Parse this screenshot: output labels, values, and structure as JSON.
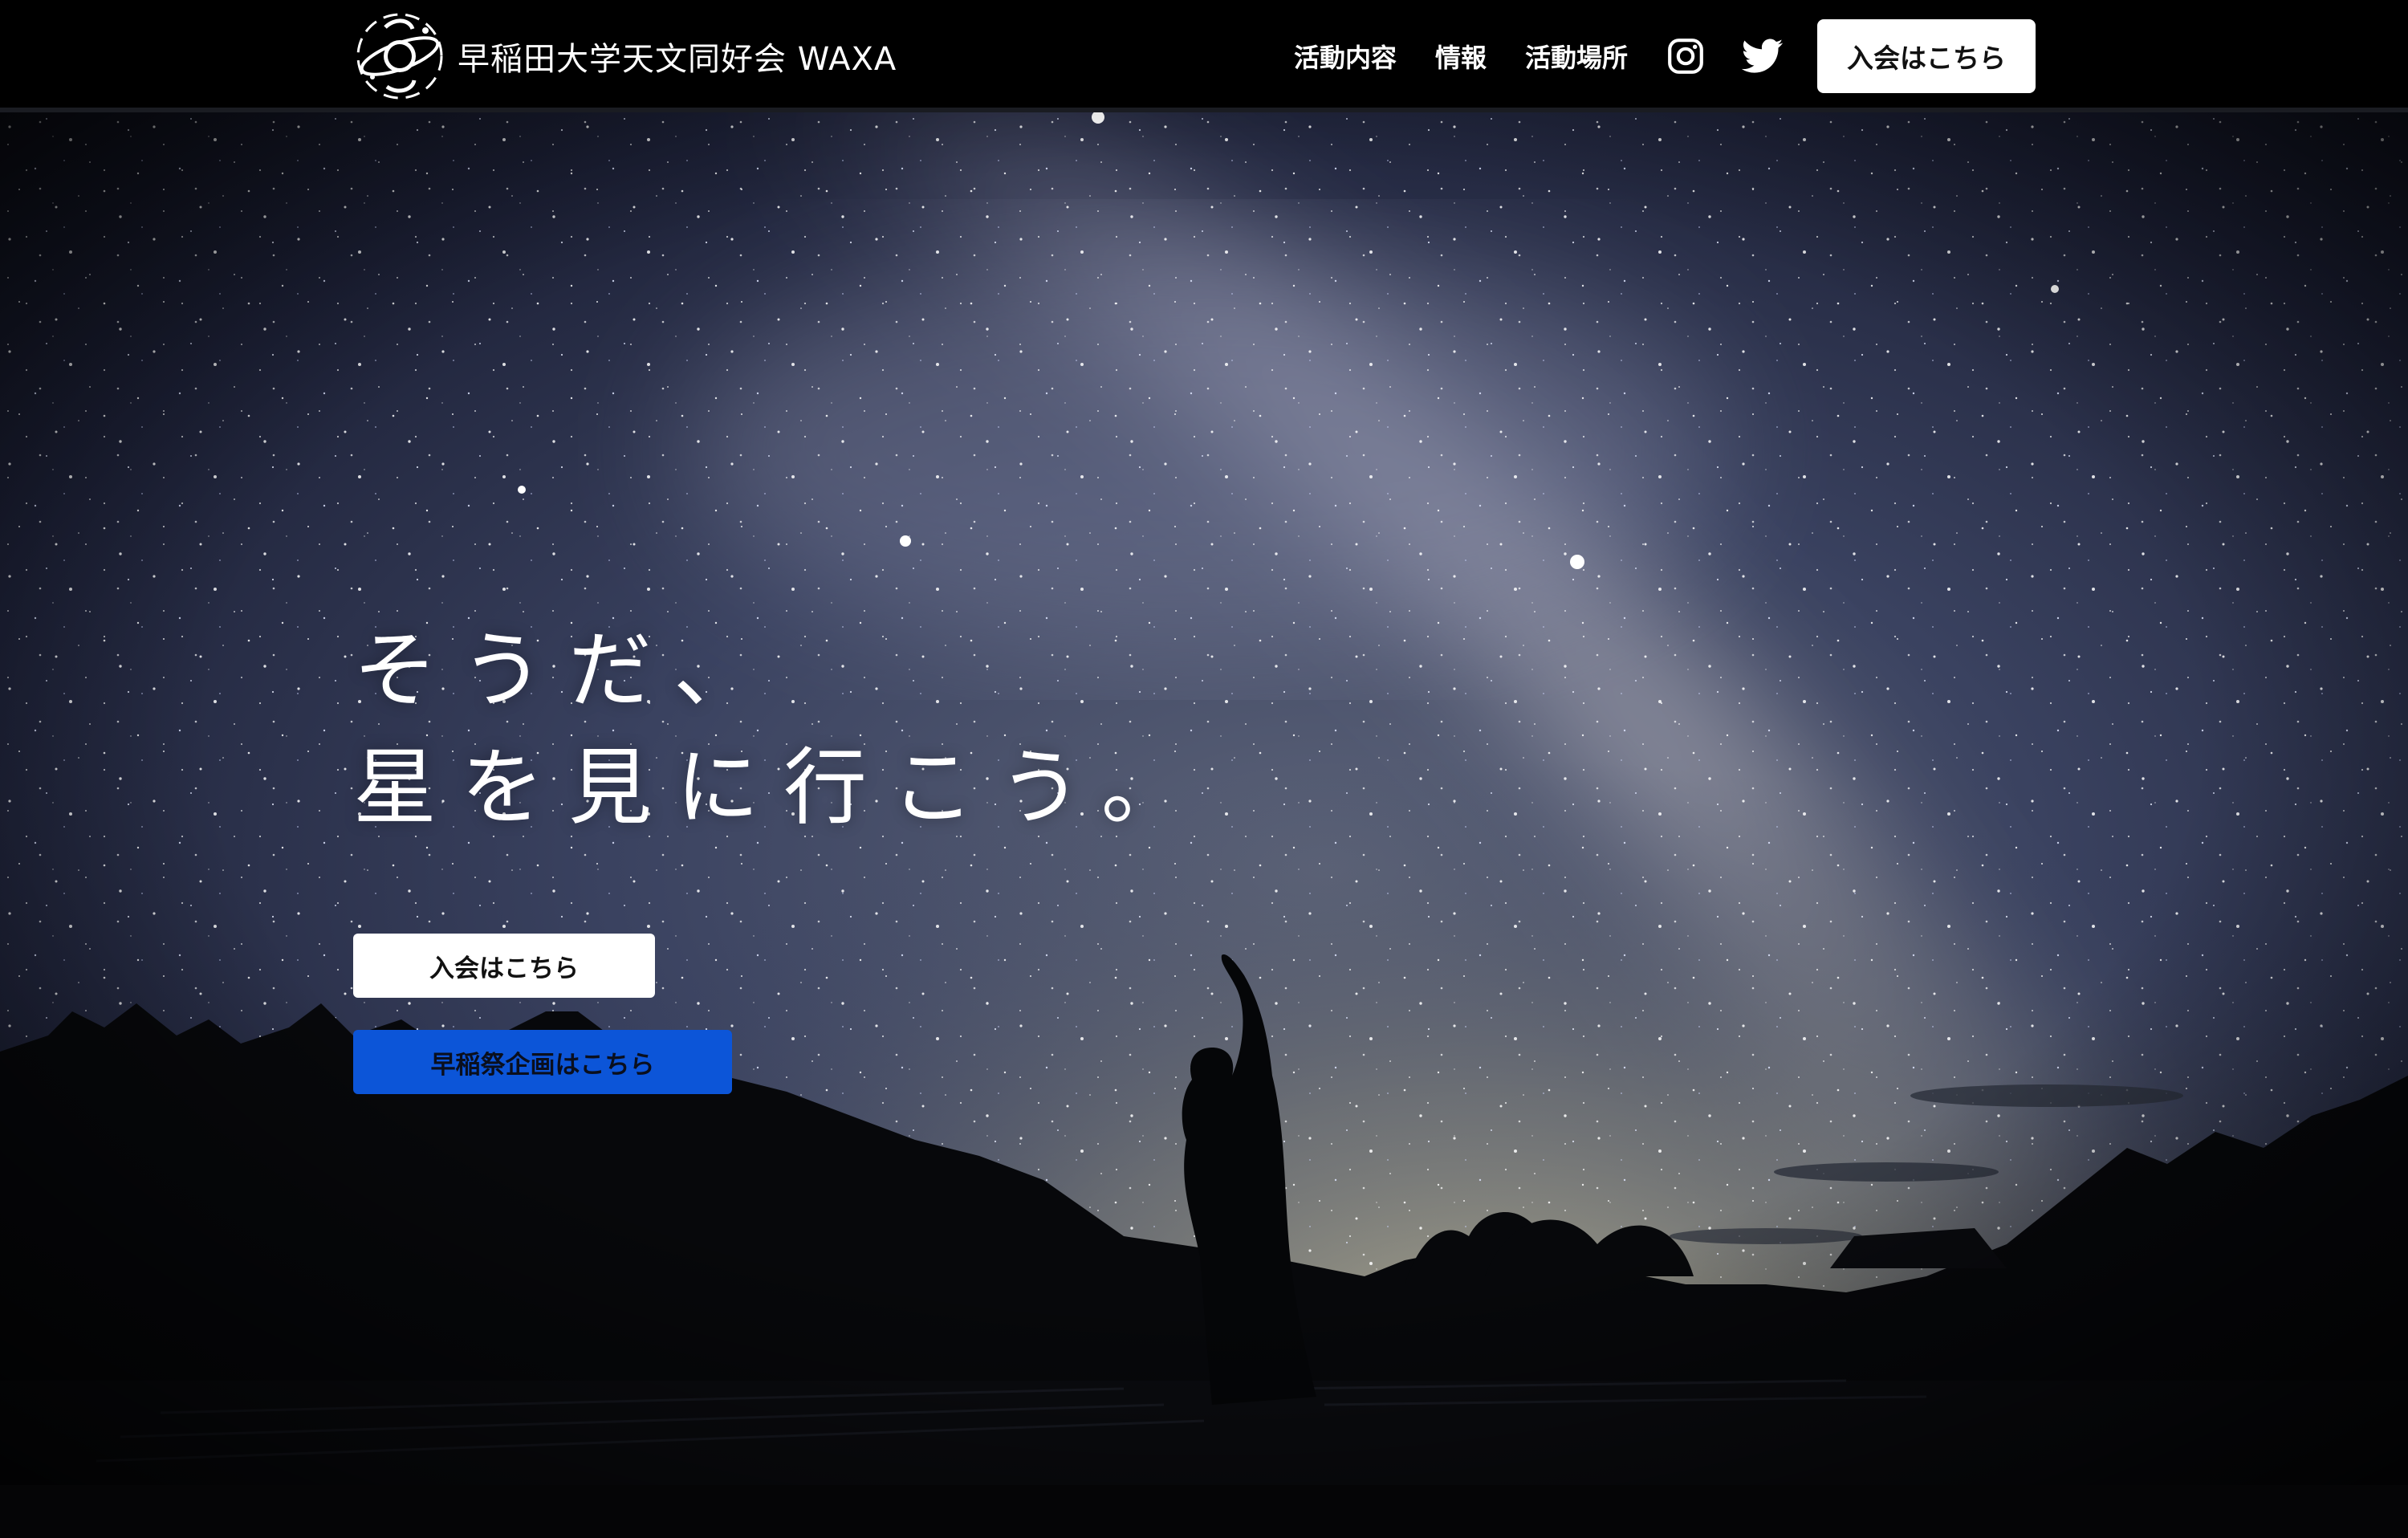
{
  "header": {
    "brand_name": "早稲田大学天文同好会 WAXA",
    "nav": [
      {
        "label": "活動内容"
      },
      {
        "label": "情報"
      },
      {
        "label": "活動場所"
      }
    ],
    "social": [
      "instagram-icon",
      "twitter-icon"
    ],
    "join_label": "入会はこちら"
  },
  "hero": {
    "tagline_line1": "そうだ、",
    "tagline_line2": "星を見に行こう。",
    "join_button": "入会はこちら",
    "festival_button": "早稲祭企画はこちら"
  },
  "colors": {
    "header_bg": "#000000",
    "festival_button": "#0c55d8",
    "button_white": "#ffffff"
  }
}
